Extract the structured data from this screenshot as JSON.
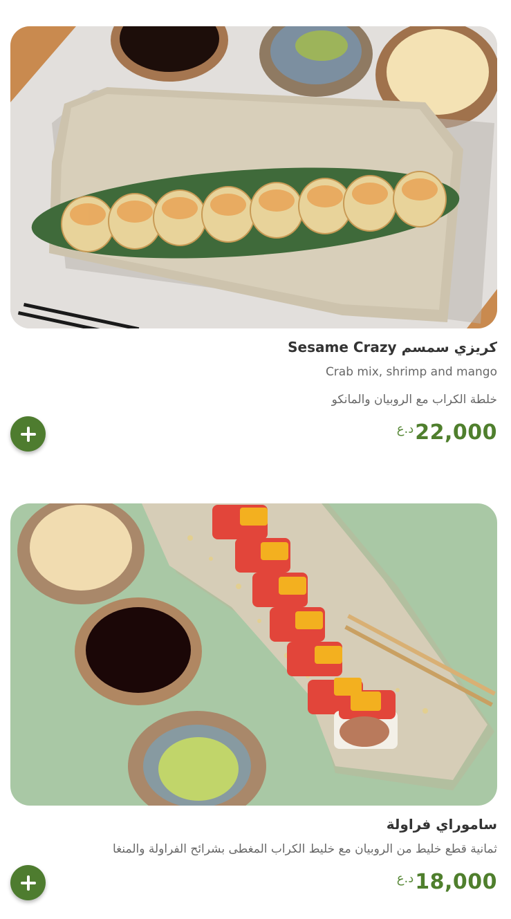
{
  "items": [
    {
      "title": "Sesame Crazy كريزي سمسم",
      "description_en": "Crab mix, shrimp and mango",
      "description_ar": "خلطة الكراب مع الروبيان والمانكو",
      "price": "22,000",
      "currency": "د.ع",
      "image_icon": "sushi-roll-photo",
      "add_icon": "plus-icon"
    },
    {
      "title": "ساموراي فراولة",
      "description_ar": "ثمانية قطع خليط من الروبيان مع خليط الكراب المغطى بشرائح الفراولة والمنغا",
      "price": "18,000",
      "currency": "د.ع",
      "image_icon": "sushi-roll-photo",
      "add_icon": "plus-icon"
    }
  ],
  "colors": {
    "price_green": "#4f7f2d",
    "button_green": "#4e7c2f",
    "title_text": "#333333",
    "description_text": "#676767"
  }
}
